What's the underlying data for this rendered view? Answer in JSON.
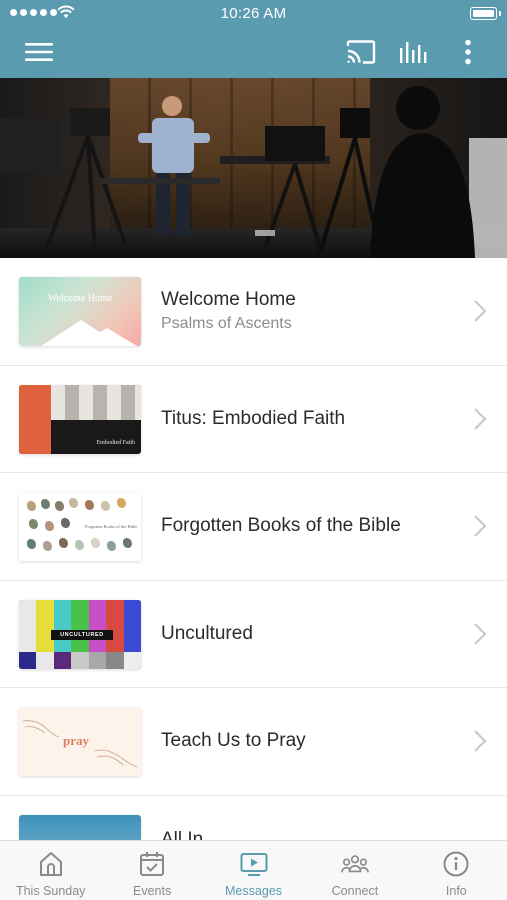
{
  "status_bar": {
    "time": "10:26 AM"
  },
  "colors": {
    "accent": "#5b9bb0",
    "tab_inactive": "#8a8a8a",
    "title_text": "#2b2b2b",
    "subtitle_text": "#8c8c8c"
  },
  "header": {
    "icons": [
      "hamburger-menu-icon",
      "cast-icon",
      "audio-bars-icon",
      "more-vertical-icon"
    ]
  },
  "hero": {
    "icon": "hero-video-image"
  },
  "series": [
    {
      "title": "Welcome Home",
      "subtitle": "Psalms of Ascents",
      "thumb_text": "Welcome Home"
    },
    {
      "title": "Titus: Embodied Faith",
      "thumb_text": "Embodied Faith"
    },
    {
      "title": "Forgotten Books of the Bible",
      "thumb_text": "Forgotten Books of the Bible"
    },
    {
      "title": "Uncultured",
      "thumb_text": "UNCULTURED"
    },
    {
      "title": "Teach Us to Pray",
      "thumb_text": "pray"
    },
    {
      "title": "All In"
    }
  ],
  "tabs": [
    {
      "label": "This Sunday",
      "icon": "church-icon",
      "active": false
    },
    {
      "label": "Events",
      "icon": "calendar-icon",
      "active": false
    },
    {
      "label": "Messages",
      "icon": "video-screen-icon",
      "active": true
    },
    {
      "label": "Connect",
      "icon": "people-group-icon",
      "active": false
    },
    {
      "label": "Info",
      "icon": "info-icon",
      "active": false
    }
  ]
}
